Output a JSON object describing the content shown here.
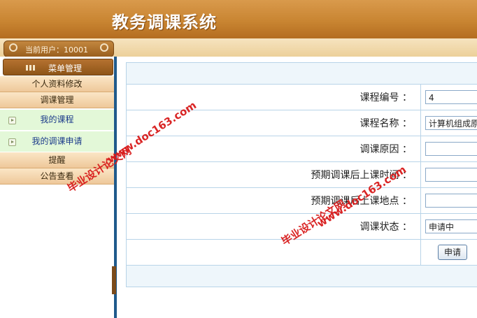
{
  "header": {
    "title": "教务调课系统"
  },
  "userbar": {
    "user_label": "当前用户：10001"
  },
  "sidebar": {
    "menu_title": "菜单管理",
    "items": [
      {
        "label": "个人资料修改"
      },
      {
        "label": "调课管理"
      },
      {
        "label": "我的课程"
      },
      {
        "label": "我的调课申请"
      },
      {
        "label": "提醒"
      },
      {
        "label": "公告查看"
      }
    ]
  },
  "form": {
    "fields": [
      {
        "label": "课程编号 ：",
        "value": "4"
      },
      {
        "label": "课程名称 ：",
        "value": "计算机组成原"
      },
      {
        "label": "调课原因 ：",
        "value": ""
      },
      {
        "label": "预期调课后上课时间 ：",
        "value": ""
      },
      {
        "label": "预期调课后上课地点 ：",
        "value": ""
      },
      {
        "label": "调课状态 ：",
        "value": "申请中"
      }
    ],
    "submit_label": "申请"
  },
  "watermarks": {
    "site": "www.doc163.com",
    "name": "毕业设计论文网"
  }
}
